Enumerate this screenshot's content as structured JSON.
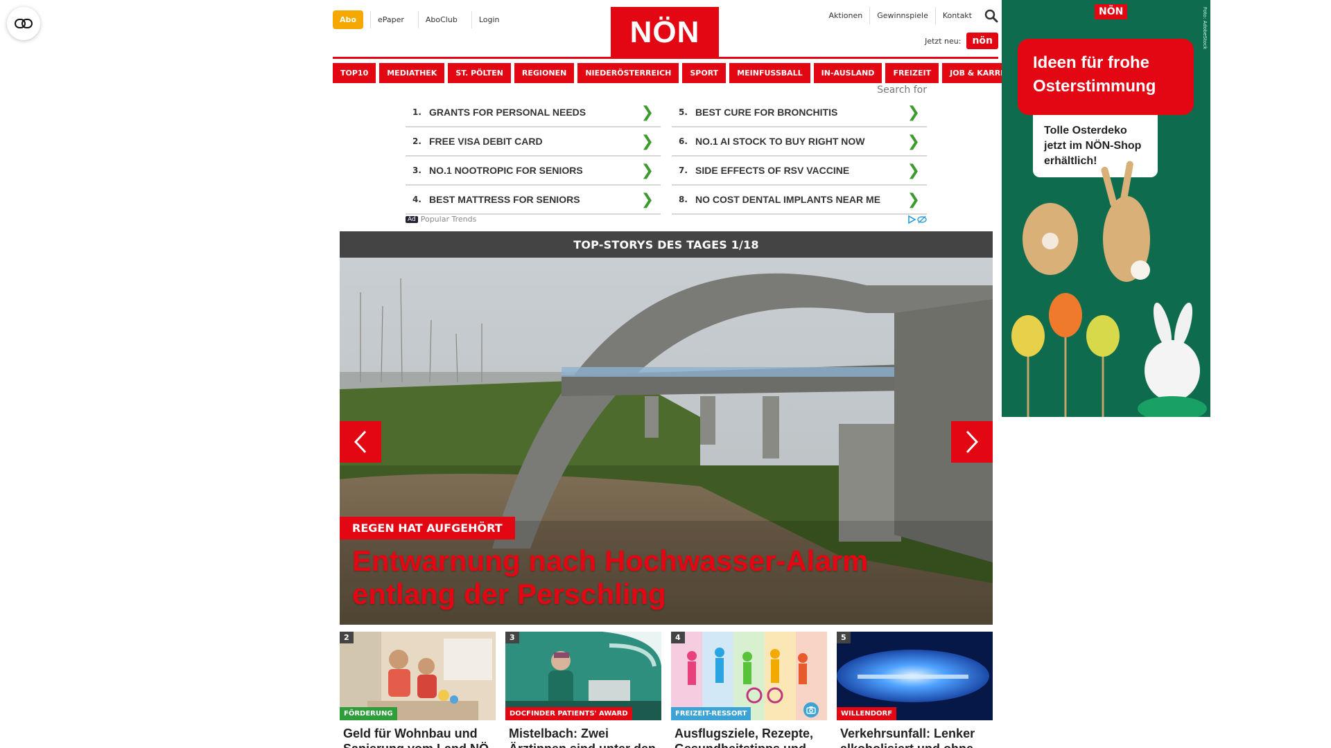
{
  "accessibility": {
    "icon": "accessibility-toggle-icon"
  },
  "header": {
    "abo_label": "Abo",
    "left_links": [
      "ePaper",
      "AboClub",
      "Login"
    ],
    "logo_text": "NÖN",
    "right_links": [
      "Aktionen",
      "Gewinnspiele",
      "Kontakt"
    ],
    "jetzt_label": "Jetzt neu:",
    "jetzt_badge": "nön"
  },
  "nav": [
    "TOP10",
    "MEDIATHEK",
    "ST. PÖLTEN",
    "REGIONEN",
    "NIEDERÖSTERREICH",
    "SPORT",
    "MEINFUSSBALL",
    "IN-AUSLAND",
    "FREIZEIT",
    "JOB & KARRIERE"
  ],
  "ad_search": {
    "search_for": "Search for",
    "items": [
      {
        "num": "1.",
        "text": "GRANTS FOR PERSONAL NEEDS"
      },
      {
        "num": "5.",
        "text": "BEST CURE FOR BRONCHITIS"
      },
      {
        "num": "2.",
        "text": "FREE VISA DEBIT CARD"
      },
      {
        "num": "6.",
        "text": "NO.1 AI STOCK TO BUY RIGHT NOW"
      },
      {
        "num": "3.",
        "text": "NO.1 NOOTROPIC FOR SENIORS"
      },
      {
        "num": "7.",
        "text": "SIDE EFFECTS OF RSV VACCINE"
      },
      {
        "num": "4.",
        "text": "BEST MATTRESS FOR SENIORS"
      },
      {
        "num": "8.",
        "text": "NO COST DENTAL IMPLANTS NEAR ME"
      }
    ],
    "ad_label": "Ad",
    "footer": "Popular Trends",
    "arrow": "❯"
  },
  "top_stories": {
    "title": "TOP-STORYS DES TAGES 1/18",
    "kicker": "REGEN HAT AUFGEHÖRT",
    "headline": "Entwarnung nach Hochwasser-Alarm entlang der Perschling"
  },
  "cards": [
    {
      "num": "2",
      "tag": "FÖRDERUNG",
      "tag_color": "#2e9e3a",
      "title": "Geld für Wohnbau und Sanierung vom Land NÖ"
    },
    {
      "num": "3",
      "tag": "DOCFINDER PATIENTS' AWARD",
      "tag_color": "#e30613",
      "title": "Mistelbach: Zwei Ärztinnen sind unter den"
    },
    {
      "num": "4",
      "tag": "FREIZEIT-RESSORT",
      "tag_color": "#3ba3d6",
      "title": "Ausflugsziele, Rezepte, Gesundheitstipps und"
    },
    {
      "num": "5",
      "tag": "WILLENDORF",
      "tag_color": "#e30613",
      "title": "Verkehrsunfall: Lenker alkoholisiert und ohne"
    }
  ],
  "side_ad": {
    "logo": "NÖN",
    "headline": "Ideen für frohe Osterstimmung",
    "subline": "Tolle Osterdeko jetzt im NÖN-Shop erhältlich!",
    "credit": "Foto: AdobeStock"
  },
  "colors": {
    "brand_red": "#e30613",
    "abo_yellow": "#f5a800",
    "ad_green": "#0e6b4e"
  }
}
